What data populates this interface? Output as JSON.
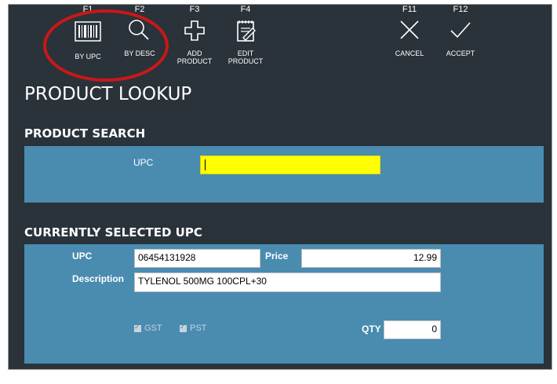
{
  "toolbar": [
    {
      "key": "F1",
      "label1": "BY UPC",
      "label2": "",
      "icon": "barcode-icon"
    },
    {
      "key": "F2",
      "label1": "BY DESC",
      "label2": "",
      "icon": "magnifier-icon"
    },
    {
      "key": "F3",
      "label1": "ADD",
      "label2": "PRODUCT",
      "icon": "plus-icon"
    },
    {
      "key": "F4",
      "label1": "EDIT",
      "label2": "PRODUCT",
      "icon": "edit-icon"
    },
    {
      "key": "F11",
      "label1": "CANCEL",
      "label2": "",
      "icon": "x-icon"
    },
    {
      "key": "F12",
      "label1": "ACCEPT",
      "label2": "",
      "icon": "check-icon"
    }
  ],
  "title": "PRODUCT LOOKUP",
  "search": {
    "heading": "PRODUCT SEARCH",
    "upc_label": "UPC",
    "upc_value": "",
    "upc_field_color": "#ffff00"
  },
  "selected": {
    "heading": "CURRENTLY SELECTED UPC",
    "upc_label": "UPC",
    "upc_value": "06454131928",
    "price_label": "Price",
    "price_value": "12.99",
    "desc_label": "Description",
    "desc_value": "TYLENOL 500MG 100CPL+30",
    "gst_label": "GST",
    "gst_checked": true,
    "pst_label": "PST",
    "pst_checked": true,
    "qty_label": "QTY",
    "qty_value": "0"
  },
  "colors": {
    "background": "#2a323a",
    "panel": "#4a8bb0",
    "highlight_circle": "#c81818"
  }
}
